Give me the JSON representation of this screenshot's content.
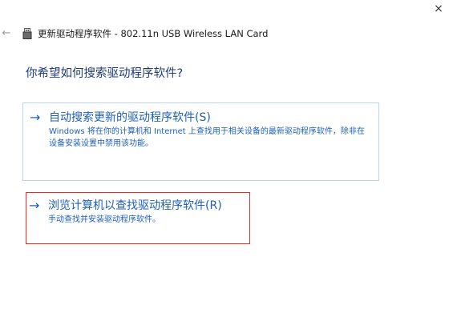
{
  "window": {
    "close_glyph": "×"
  },
  "header": {
    "back_glyph": "←",
    "device_icon": "device-icon",
    "title": "更新驱动程序软件 - 802.11n USB Wireless LAN Card"
  },
  "question": "你希望如何搜索驱动程序软件?",
  "options": [
    {
      "arrow": "→",
      "title": "自动搜索更新的驱动程序软件(S)",
      "description": "Windows 将在你的计算机和 Internet 上查找用于相关设备的最新驱动程序软件，除非在设备安装设置中禁用该功能。"
    },
    {
      "arrow": "→",
      "title": "浏览计算机以查找驱动程序软件(R)",
      "description": "手动查找并安装驱动程序软件。"
    }
  ],
  "colors": {
    "link_blue": "#1f5fb8",
    "heading_blue": "#1f3b78",
    "option_border": "#b9d6ee",
    "highlight_red": "#e0302e"
  }
}
